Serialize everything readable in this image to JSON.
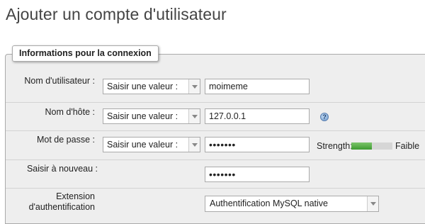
{
  "page": {
    "title": "Ajouter un compte d'utilisateur"
  },
  "fieldset": {
    "legend": "Informations pour la connexion"
  },
  "rows": {
    "username": {
      "label": "Nom d'utilisateur :",
      "select_value": "Saisir une valeur :",
      "input_value": "moimeme"
    },
    "hostname": {
      "label": "Nom d'hôte :",
      "select_value": "Saisir une valeur :",
      "input_value": "127.0.0.1",
      "help_icon": "help-icon"
    },
    "password": {
      "label": "Mot de passe :",
      "select_value": "Saisir une valeur :",
      "input_value": "•••••••",
      "strength_label": "Strength:",
      "strength_value": "Faible",
      "strength_fraction": 0.5,
      "strength_color": "#3e9b31"
    },
    "retype": {
      "label": "Saisir à nouveau :",
      "input_value": "•••••••"
    },
    "auth_plugin": {
      "label_line1": "Extension",
      "label_line2": "d'authentification",
      "select_value": "Authentification MySQL native"
    }
  },
  "icons": {
    "dropdown": "chevron-down-icon"
  }
}
